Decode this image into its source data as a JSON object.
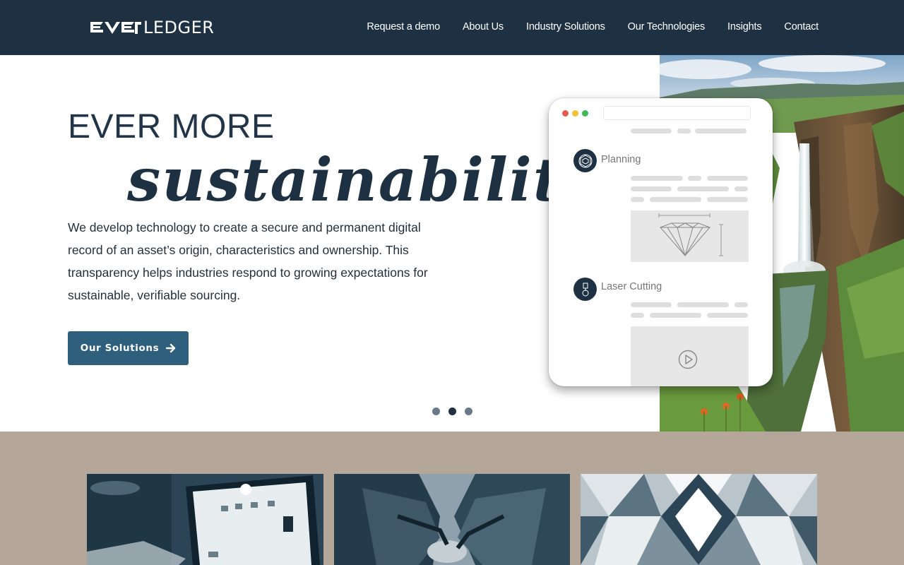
{
  "header": {
    "logo": {
      "text_left": "EVER",
      "text_right": "LEDGER"
    },
    "nav": [
      {
        "label": "Request a demo"
      },
      {
        "label": "About Us"
      },
      {
        "label": "Industry Solutions"
      },
      {
        "label": "Our Technologies"
      },
      {
        "label": "Insights"
      },
      {
        "label": "Contact"
      }
    ]
  },
  "hero": {
    "title_line1": "EVER MORE",
    "title_line2": "sustainability",
    "description": "We develop technology to create a secure and permanent digital record of an asset’s origin, characteristics and ownership. This transparency helps industries respond to growing expectations for sustainable, verifiable sourcing.",
    "cta_label": "Our Solutions",
    "cta_icon": "arrow-right-icon",
    "carousel": {
      "count": 3,
      "active_index": 1
    },
    "mockup": {
      "step1_label": "Planning",
      "step1_icon": "diamond-facet-icon",
      "step2_label": "Laser Cutting",
      "step2_icon": "laser-icon",
      "play_icon": "play-circle-icon",
      "traffic_lights": [
        "#e8594f",
        "#f1c232",
        "#3ebb58"
      ]
    }
  },
  "colors": {
    "header_bg": "#1e3142",
    "cta_bg": "#2e607e",
    "lower_bg": "#b4a699",
    "title": "#223548"
  }
}
